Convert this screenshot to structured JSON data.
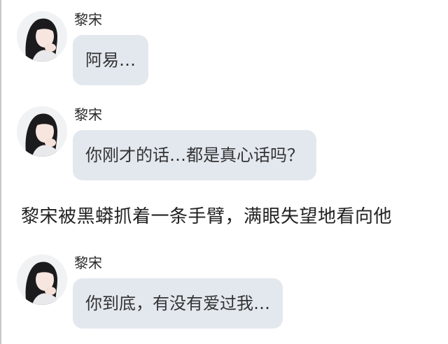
{
  "messages": [
    {
      "sender": "黎宋",
      "text": "阿易…"
    },
    {
      "sender": "黎宋",
      "text": "你刚才的话…都是真心话吗？"
    },
    {
      "sender": "黎宋",
      "text": "你到底，有没有爱过我…"
    }
  ],
  "narration": "黎宋被黑蟒抓着一条手臂，满眼失望地看向他",
  "colors": {
    "bubble": "#e3e8ef",
    "page": "#ffffff",
    "text": "#222222"
  },
  "icons": [
    "avatar"
  ]
}
